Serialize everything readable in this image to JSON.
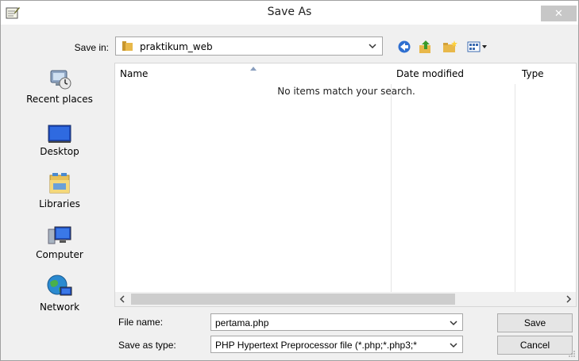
{
  "window": {
    "title": "Save As",
    "close_label": "✕"
  },
  "toolbar": {
    "save_in_label": "Save in:",
    "location": "praktikum_web",
    "icons": [
      "back-icon",
      "up-folder-icon",
      "new-folder-icon",
      "view-menu-icon"
    ]
  },
  "places": [
    {
      "label": "Recent places",
      "icon": "recent-places-icon"
    },
    {
      "label": "Desktop",
      "icon": "desktop-icon"
    },
    {
      "label": "Libraries",
      "icon": "libraries-icon"
    },
    {
      "label": "Computer",
      "icon": "computer-icon"
    },
    {
      "label": "Network",
      "icon": "network-icon"
    }
  ],
  "file_list": {
    "columns": [
      "Name",
      "Date modified",
      "Type"
    ],
    "empty_message": "No items match your search."
  },
  "form": {
    "file_name_label": "File name:",
    "file_name_value": "pertama.php",
    "save_as_type_label": "Save as type:",
    "save_as_type_value": "PHP Hypertext Preprocessor file (*.php;*.php3;*"
  },
  "buttons": {
    "save": "Save",
    "cancel": "Cancel"
  },
  "colors": {
    "title_bg": "#ffffff",
    "dialog_bg": "#f0f0f0",
    "close_button": "#c7c7c7",
    "folder_yellow": "#e8b84a"
  }
}
